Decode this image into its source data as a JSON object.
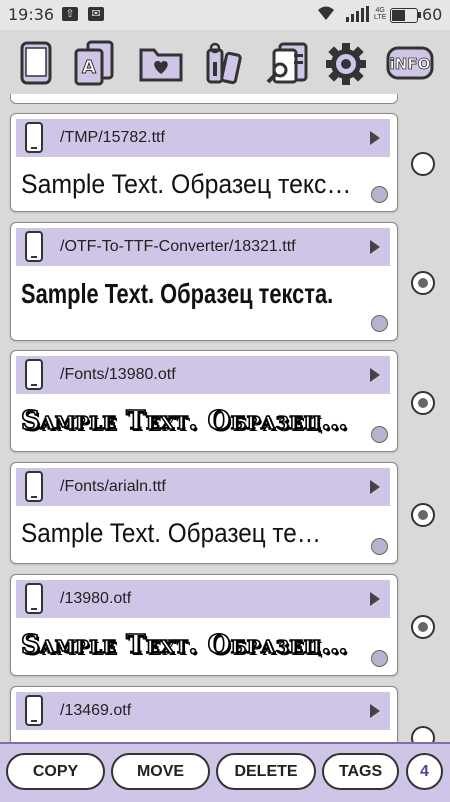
{
  "status": {
    "time": "19:36",
    "network": "4G LTE",
    "battery_pct": "60",
    "battery_level": 0.6
  },
  "toolbar": {
    "icons": [
      "device-icon",
      "font-preview-icon",
      "favorites-folder-icon",
      "tags-icon",
      "search-files-icon",
      "settings-icon",
      "info-icon"
    ],
    "info_label": "iNFO"
  },
  "items": [
    {
      "path": "/TMP/15782.ttf",
      "sample": "Sample Text. Образец текста.",
      "selected": false
    },
    {
      "path": "/OTF-To-TTF-Converter/18321.ttf",
      "sample": "Sample Text. Образец текста.",
      "selected": true
    },
    {
      "path": "/Fonts/13980.otf",
      "sample": "Sample Text. Образец…",
      "selected": true
    },
    {
      "path": "/Fonts/arialn.ttf",
      "sample": "Sample Text. Образец те…",
      "selected": true
    },
    {
      "path": "/13980.otf",
      "sample": "Sample Text. Образец…",
      "selected": true
    },
    {
      "path": "/13469.otf",
      "sample": "",
      "selected": false
    }
  ],
  "actions": {
    "copy": "COPY",
    "move": "MOVE",
    "delete": "DELETE",
    "tags": "TAGS",
    "selected_count": "4"
  },
  "colors": {
    "accent": "#cfc5e6",
    "bar_border": "#7d6fae",
    "count_text": "#5a3f9a"
  }
}
